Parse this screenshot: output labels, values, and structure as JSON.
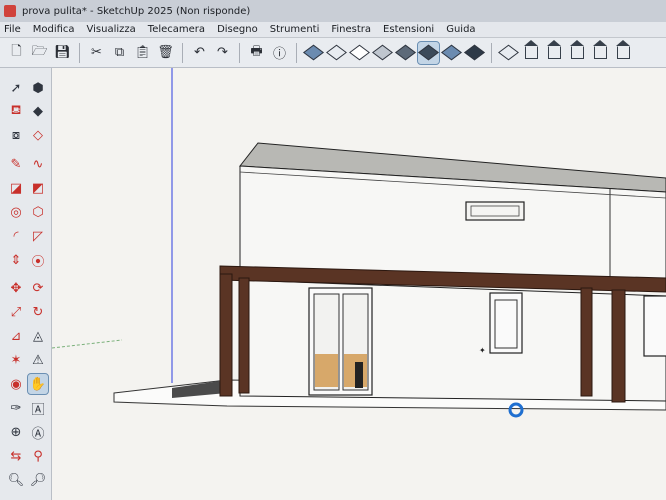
{
  "window": {
    "title": "prova pulita* - SketchUp 2025 (Non risponde)"
  },
  "menu": [
    "File",
    "Modifica",
    "Visualizza",
    "Telecamera",
    "Disegno",
    "Strumenti",
    "Finestra",
    "Estensioni",
    "Guida"
  ],
  "toolbar": {
    "icons": [
      "new-file-icon",
      "open-folder-icon",
      "save-icon",
      "cut-icon",
      "copy-icon",
      "paste-icon",
      "erase-icon",
      "undo-icon",
      "redo-icon",
      "print-icon",
      "model-info-icon",
      "xray-style-icon",
      "back-edges-style-icon",
      "wireframe-style-icon",
      "hidden-line-style-icon",
      "shaded-style-icon",
      "shaded-textures-style-icon",
      "monochrome-style-icon",
      "iso-view-icon",
      "top-view-icon",
      "front-view-icon",
      "right-view-icon",
      "back-view-icon",
      "left-view-icon"
    ],
    "active": "shaded-textures-style-icon"
  },
  "palette": {
    "active": "move-tool",
    "tools": [
      "select-tool",
      "component-tool",
      "paint-bucket-tool",
      "eraser-tool",
      "tag-tool",
      "eraser-soft-tool",
      "pencil-tool",
      "freehand-tool",
      "rectangle-tool",
      "rotated-rectangle-tool",
      "circle-tool",
      "polygon-tool",
      "arc-tool",
      "pie-tool",
      "push-pull-tool",
      "follow-me-tool",
      "move-tool",
      "rotate-tool",
      "scale-tool",
      "offset-tool",
      "tape-measure-tool",
      "protractor-tool",
      "axes-tool",
      "dimension-tool",
      "orbit-tool",
      "pan-tool",
      "text-tool",
      "section-plane-tool",
      "walk-tool",
      "look-around-tool",
      "zoom-tool",
      "zoom-extents-tool"
    ]
  }
}
